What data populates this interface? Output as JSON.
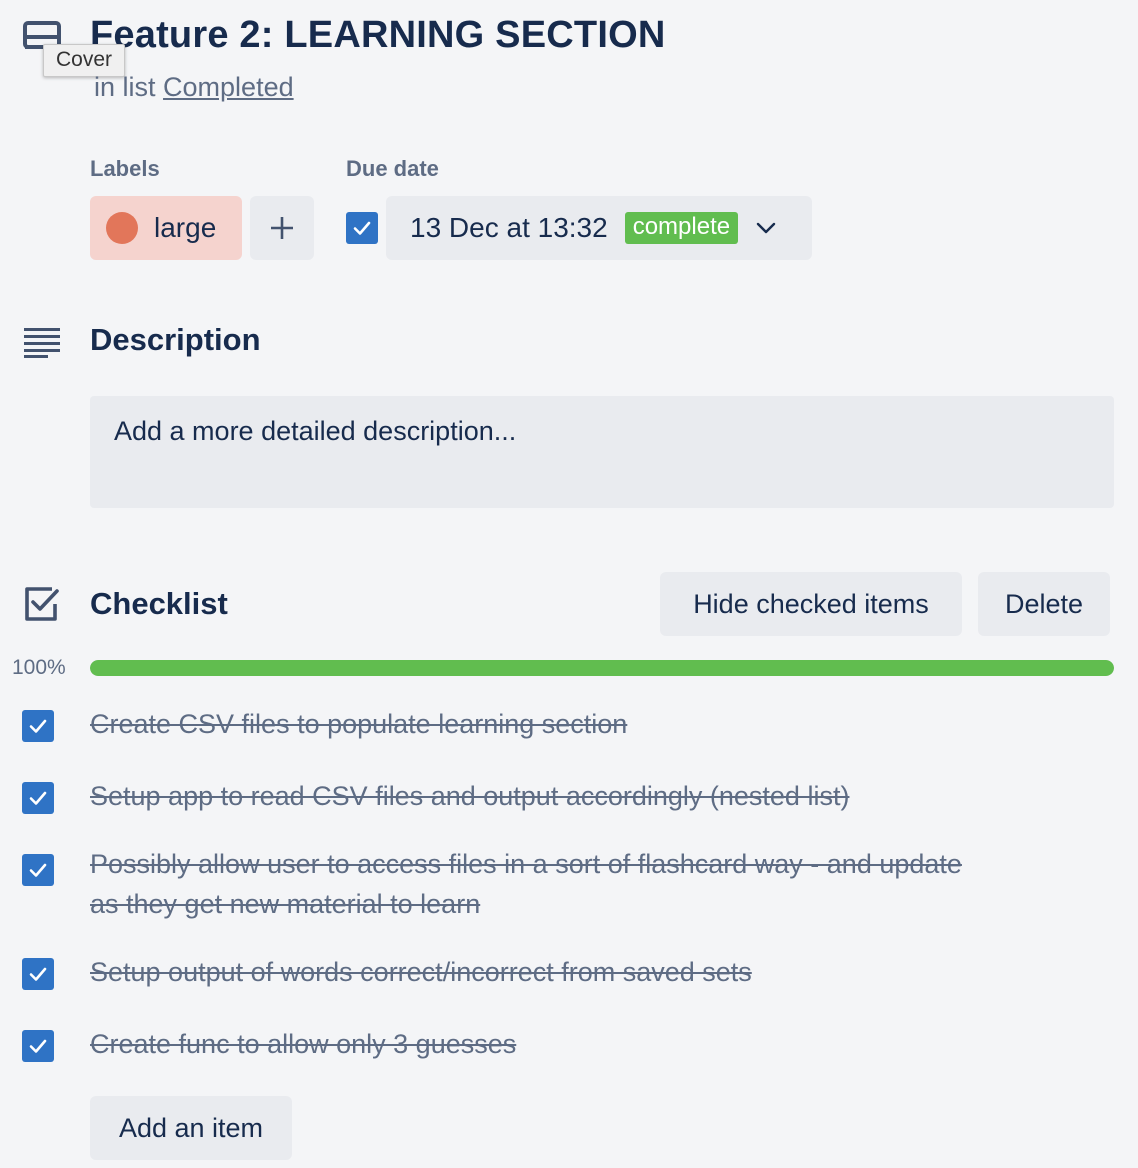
{
  "card": {
    "title": "Feature 2: LEARNING SECTION",
    "in_list_prefix": "in list",
    "list_name": "Completed",
    "cover_tooltip": "Cover"
  },
  "labels": {
    "heading": "Labels",
    "items": [
      {
        "name": "large",
        "color": "#e2765a"
      }
    ],
    "add_icon": "plus-icon"
  },
  "due_date": {
    "heading": "Due date",
    "checked": true,
    "value": "13 Dec at 13:32",
    "status": "complete",
    "status_color": "#61bd4f"
  },
  "description": {
    "heading": "Description",
    "placeholder": "Add a more detailed description..."
  },
  "checklist": {
    "heading": "Checklist",
    "hide_button": "Hide checked items",
    "delete_button": "Delete",
    "progress_label": "100%",
    "progress_fraction": 1.0,
    "items": [
      {
        "text": "Create CSV files to populate learning section",
        "checked": true
      },
      {
        "text": "Setup app to read CSV files and output accordingly (nested list)",
        "checked": true
      },
      {
        "text": "Possibly allow user to access files in a sort of flashcard way - and update as they get new material to learn",
        "checked": true
      },
      {
        "text": "Setup output of words correct/incorrect from saved sets",
        "checked": true
      },
      {
        "text": "Create func to allow only 3 guesses",
        "checked": true
      }
    ],
    "add_item_button": "Add an item"
  },
  "colors": {
    "accent": "#2f73c5",
    "success": "#61bd4f",
    "text": "#172b4d",
    "muted": "#5e6c84"
  }
}
